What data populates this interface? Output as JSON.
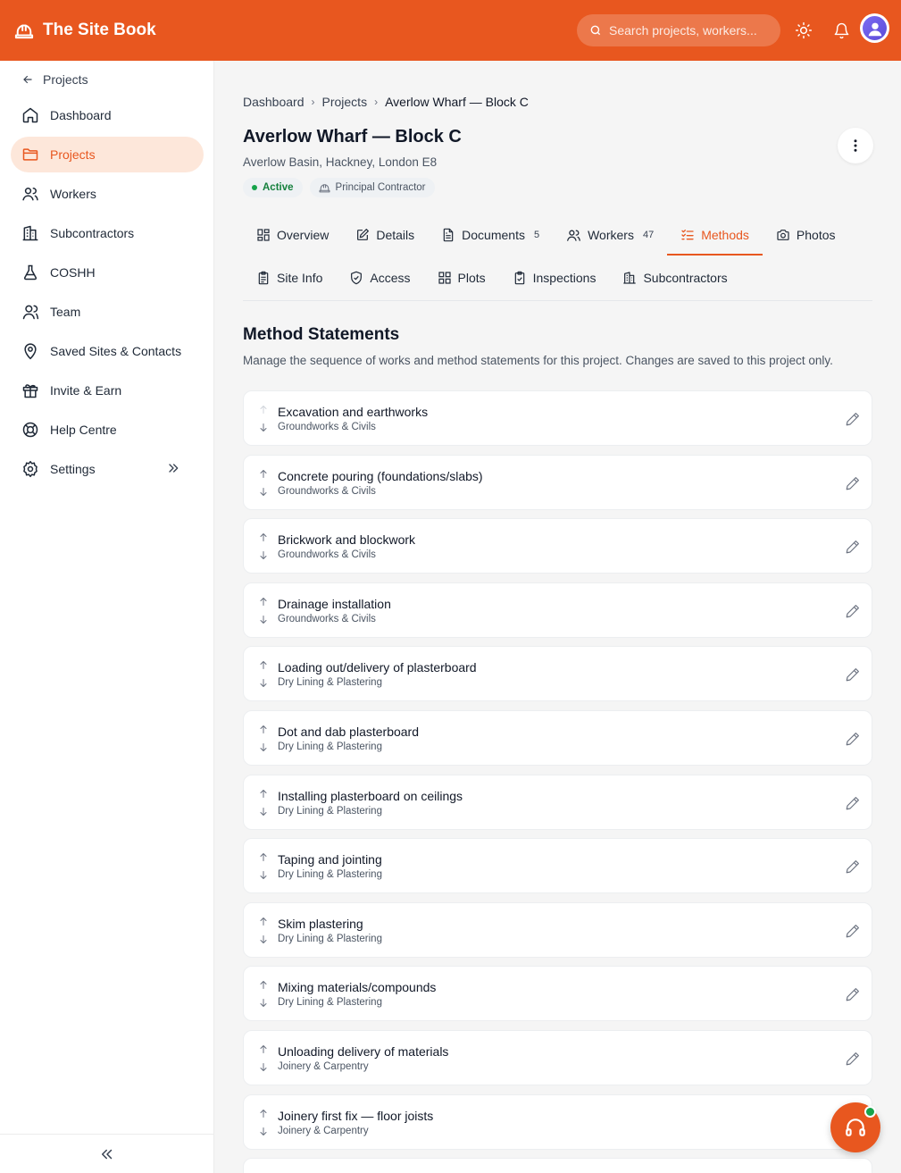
{
  "app": {
    "name": "The Site Book"
  },
  "search": {
    "placeholder": "Search projects, workers..."
  },
  "sidebar": {
    "back_label": "Projects",
    "items": [
      {
        "label": "Dashboard",
        "icon": "home-icon"
      },
      {
        "label": "Projects",
        "icon": "folder-icon",
        "active": true
      },
      {
        "label": "Workers",
        "icon": "users-icon"
      },
      {
        "label": "Subcontractors",
        "icon": "building-icon"
      },
      {
        "label": "COSHH",
        "icon": "flask-icon"
      },
      {
        "label": "Team",
        "icon": "team-icon"
      },
      {
        "label": "Saved Sites & Contacts",
        "icon": "map-pin-icon"
      },
      {
        "label": "Invite & Earn",
        "icon": "gift-icon"
      },
      {
        "label": "Help Centre",
        "icon": "lifebuoy-icon"
      },
      {
        "label": "Settings",
        "icon": "gear-icon"
      }
    ]
  },
  "breadcrumb": [
    "Dashboard",
    "Projects",
    "Averlow Wharf — Block C"
  ],
  "project": {
    "title": "Averlow Wharf — Block C",
    "address": "Averlow Basin, Hackney, London E8",
    "status": "Active",
    "role": "Principal Contractor"
  },
  "tabs_row1": [
    {
      "label": "Overview",
      "icon": "grid-icon"
    },
    {
      "label": "Details",
      "icon": "edit-square-icon"
    },
    {
      "label": "Documents",
      "icon": "document-icon",
      "count": "5"
    },
    {
      "label": "Workers",
      "icon": "users-icon",
      "count": "47"
    },
    {
      "label": "Methods",
      "icon": "checklist-icon",
      "active": true
    },
    {
      "label": "Photos",
      "icon": "camera-icon"
    }
  ],
  "tabs_row2": [
    {
      "label": "Site Info",
      "icon": "clipboard-icon"
    },
    {
      "label": "Access",
      "icon": "shield-icon"
    },
    {
      "label": "Plots",
      "icon": "grid-icon"
    },
    {
      "label": "Inspections",
      "icon": "clipboard-check-icon"
    },
    {
      "label": "Subcontractors",
      "icon": "building-icon"
    }
  ],
  "methods": {
    "title": "Method Statements",
    "description": "Manage the sequence of works and method statements for this project. Changes are saved to this project only.",
    "items": [
      {
        "title": "Excavation and earthworks",
        "category": "Groundworks & Civils"
      },
      {
        "title": "Concrete pouring (foundations/slabs)",
        "category": "Groundworks & Civils"
      },
      {
        "title": "Brickwork and blockwork",
        "category": "Groundworks & Civils"
      },
      {
        "title": "Drainage installation",
        "category": "Groundworks & Civils"
      },
      {
        "title": "Loading out/delivery of plasterboard",
        "category": "Dry Lining & Plastering"
      },
      {
        "title": "Dot and dab plasterboard",
        "category": "Dry Lining & Plastering"
      },
      {
        "title": "Installing plasterboard on ceilings",
        "category": "Dry Lining & Plastering"
      },
      {
        "title": "Taping and jointing",
        "category": "Dry Lining & Plastering"
      },
      {
        "title": "Skim plastering",
        "category": "Dry Lining & Plastering"
      },
      {
        "title": "Mixing materials/compounds",
        "category": "Dry Lining & Plastering"
      },
      {
        "title": "Unloading delivery of materials",
        "category": "Joinery & Carpentry"
      },
      {
        "title": "Joinery first fix — floor joists",
        "category": "Joinery & Carpentry"
      },
      {
        "title": "",
        "category": ""
      }
    ]
  },
  "colors": {
    "brand": "#e8571f",
    "active_bg": "#fde7da",
    "status_green": "#16a34a"
  }
}
